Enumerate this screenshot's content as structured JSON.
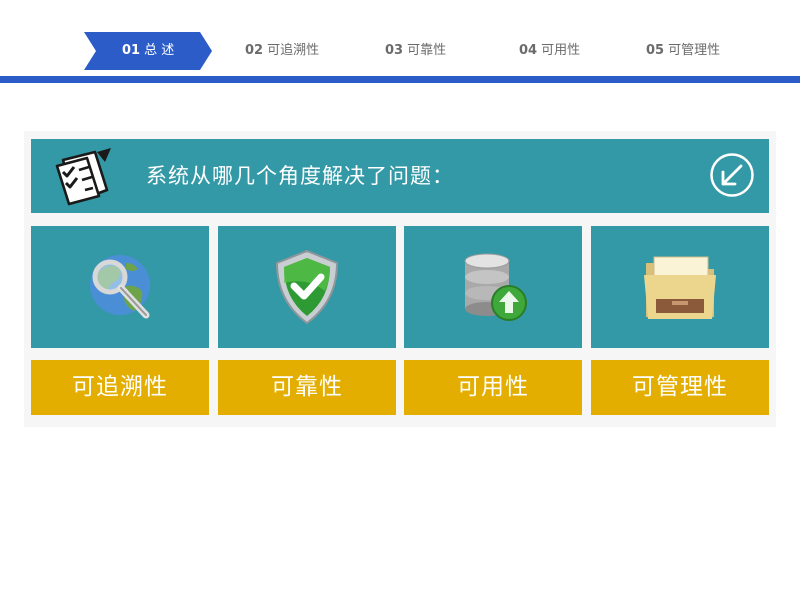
{
  "nav": {
    "steps": [
      {
        "num": "01",
        "label": "总 述",
        "active": true
      },
      {
        "num": "02",
        "label": "可追溯性",
        "active": false
      },
      {
        "num": "03",
        "label": "可靠性",
        "active": false
      },
      {
        "num": "04",
        "label": "可用性",
        "active": false
      },
      {
        "num": "05",
        "label": "可管理性",
        "active": false
      }
    ],
    "active_color": "#2b5cc8"
  },
  "header": {
    "title": "系统从哪几个角度解决了问题：",
    "icon": "checklist-icon",
    "action_icon": "arrow-down-left-circle-icon",
    "color": "#3399a6"
  },
  "features": [
    {
      "label": "可追溯性",
      "icon": "globe-magnifier-icon"
    },
    {
      "label": "可靠性",
      "icon": "shield-check-icon"
    },
    {
      "label": "可用性",
      "icon": "database-upload-icon"
    },
    {
      "label": "可管理性",
      "icon": "folder-icon"
    }
  ],
  "colors": {
    "tile": "#3399a6",
    "label": "#e3ae00",
    "nav_bar": "#2b5cc8"
  }
}
